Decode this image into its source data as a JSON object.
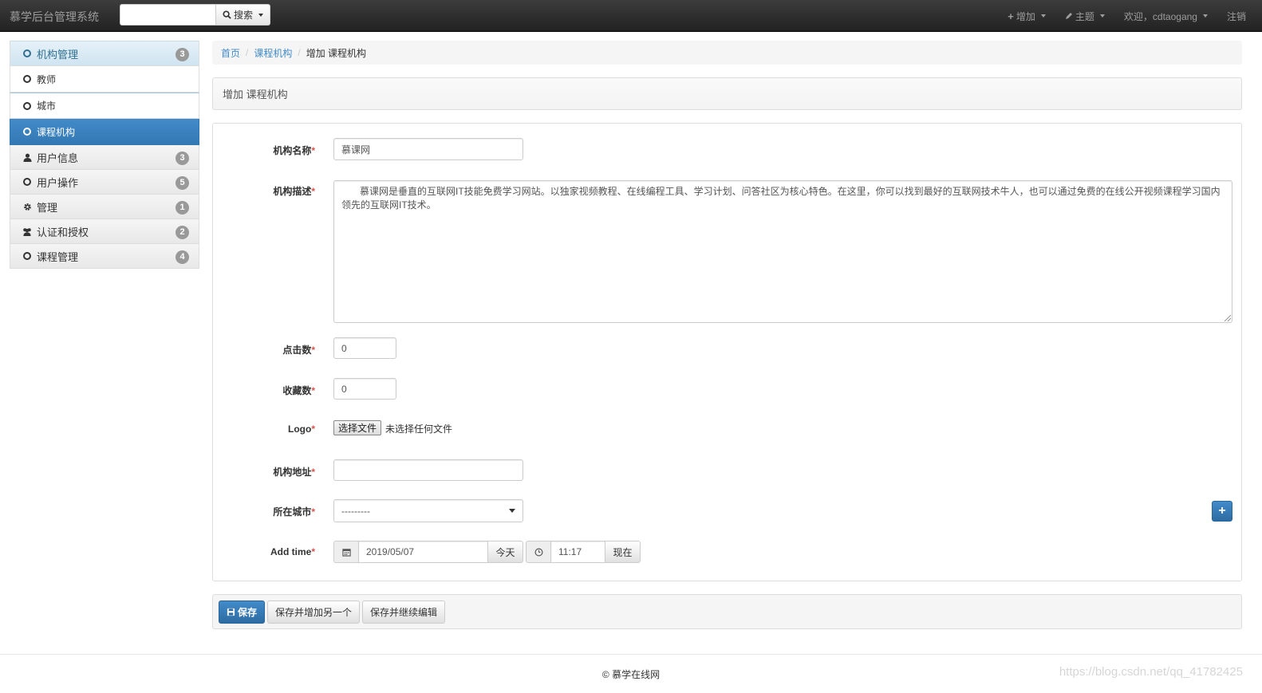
{
  "navbar": {
    "brand": "慕学后台管理系统",
    "search_value": "",
    "search_button": "搜索",
    "add_menu": "增加",
    "theme_menu": "主题",
    "user_menu": "欢迎，cdtaogang",
    "logout": "注销"
  },
  "sidebar": {
    "items": [
      {
        "label": "机构管理",
        "badge": "3",
        "icon": "circle-icon"
      },
      {
        "label": "教师",
        "icon": "circle-icon"
      },
      {
        "label": "城市",
        "icon": "circle-icon"
      },
      {
        "label": "课程机构",
        "icon": "circle-icon"
      },
      {
        "label": "用户信息",
        "badge": "3",
        "icon": "user-icon"
      },
      {
        "label": "用户操作",
        "badge": "5",
        "icon": "circle-icon"
      },
      {
        "label": "管理",
        "badge": "1",
        "icon": "gear-icon"
      },
      {
        "label": "认证和授权",
        "badge": "2",
        "icon": "users-icon"
      },
      {
        "label": "课程管理",
        "badge": "4",
        "icon": "circle-icon"
      }
    ]
  },
  "breadcrumb": {
    "items": [
      "首页",
      "课程机构",
      "增加 课程机构"
    ]
  },
  "page_title": "增加 课程机构",
  "form": {
    "name_label": "机构名称",
    "name_value": "慕课网",
    "desc_label": "机构描述",
    "desc_value": "慕课网是垂直的互联网IT技能免费学习网站。以独家视频教程、在线编程工具、学习计划、问答社区为核心特色。在这里，你可以找到最好的互联网技术牛人，也可以通过免费的在线公开视频课程学习国内领先的互联网IT技术。",
    "click_label": "点击数",
    "click_value": "0",
    "fav_label": "收藏数",
    "fav_value": "0",
    "logo_label": "Logo",
    "file_button": "选择文件",
    "file_status": "未选择任何文件",
    "address_label": "机构地址",
    "address_value": "",
    "city_label": "所在城市",
    "city_value": "---------",
    "addtime_label": "Add time",
    "date_value": "2019/05/07",
    "today_button": "今天",
    "time_value": "11:17",
    "now_button": "现在",
    "required_mark": "*"
  },
  "actions": {
    "save": "保存",
    "save_add": "保存并增加另一个",
    "save_continue": "保存并继续编辑"
  },
  "footer": {
    "copyright": "© 慕学在线网",
    "watermark": "https://blog.csdn.net/qq_41782425"
  },
  "colors": {
    "primary": "#428bca",
    "required": "#d9534f",
    "navbar": "#222222"
  }
}
